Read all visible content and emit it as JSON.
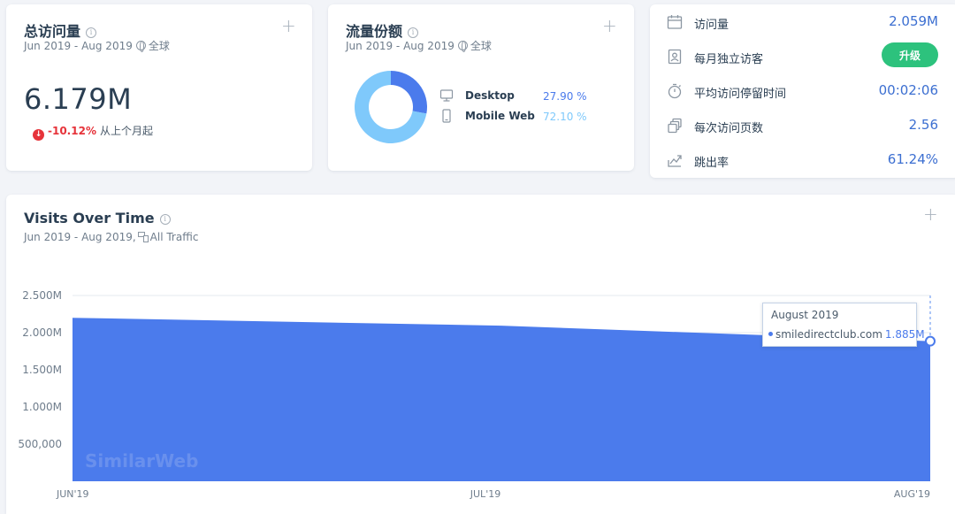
{
  "colors": {
    "accent": "#4b7bec",
    "desktop": "#4b7bec",
    "mobile": "#7fc9fb",
    "negative": "#e6333a",
    "upgrade": "#2dc27d",
    "value_text": "#3c6fd1"
  },
  "total_visits": {
    "title": "总访问量",
    "date_range": "Jun 2019 - Aug 2019",
    "scope": "全球",
    "value": "6.179M",
    "change_value": "-10.12%",
    "change_text": "从上个月起",
    "icons": {
      "info": "info-icon",
      "add": "plus-icon",
      "scope": "globe-icon",
      "change": "down-arrow-icon"
    }
  },
  "traffic_share": {
    "title": "流量份额",
    "date_range": "Jun 2019 - Aug 2019",
    "scope": "全球",
    "items": [
      {
        "label": "Desktop",
        "percent": "27.90 %",
        "share": 27.9,
        "icon": "desktop-icon"
      },
      {
        "label": "Mobile Web",
        "percent": "72.10 %",
        "share": 72.1,
        "icon": "mobile-icon"
      }
    ]
  },
  "metrics": [
    {
      "label": "访问量",
      "value": "2.059M",
      "icon": "calendar-icon"
    },
    {
      "label": "每月独立访客",
      "value": "",
      "button": "升级",
      "icon": "id-card-icon"
    },
    {
      "label": "平均访问停留时间",
      "value": "00:02:06",
      "icon": "stopwatch-icon"
    },
    {
      "label": "每次访问页数",
      "value": "2.56",
      "icon": "pages-icon"
    },
    {
      "label": "跳出率",
      "value": "61.24%",
      "icon": "bounce-icon"
    }
  ],
  "visits_over_time": {
    "title": "Visits Over Time",
    "date_range": "Jun 2019 - Aug 2019,",
    "traffic_label": "All Traffic",
    "watermark": "SimilarWeb",
    "tooltip": {
      "title": "August 2019",
      "site": "smiledirectclub.com",
      "value": "1.885M"
    }
  },
  "chart_data": {
    "type": "area",
    "x": [
      "JUN'19",
      "JUL'19",
      "AUG'19"
    ],
    "series": [
      {
        "name": "smiledirectclub.com",
        "values": [
          2200000,
          2094000,
          1885000
        ]
      }
    ],
    "y_ticks": [
      "2.500M",
      "2.000M",
      "1.500M",
      "1.000M",
      "500,000"
    ],
    "y_tick_values": [
      2500000,
      2000000,
      1500000,
      1000000,
      500000
    ],
    "ylim": [
      0,
      2500000
    ],
    "grid": true,
    "highlighted_point": {
      "x": "AUG'19",
      "value": 1885000
    }
  }
}
